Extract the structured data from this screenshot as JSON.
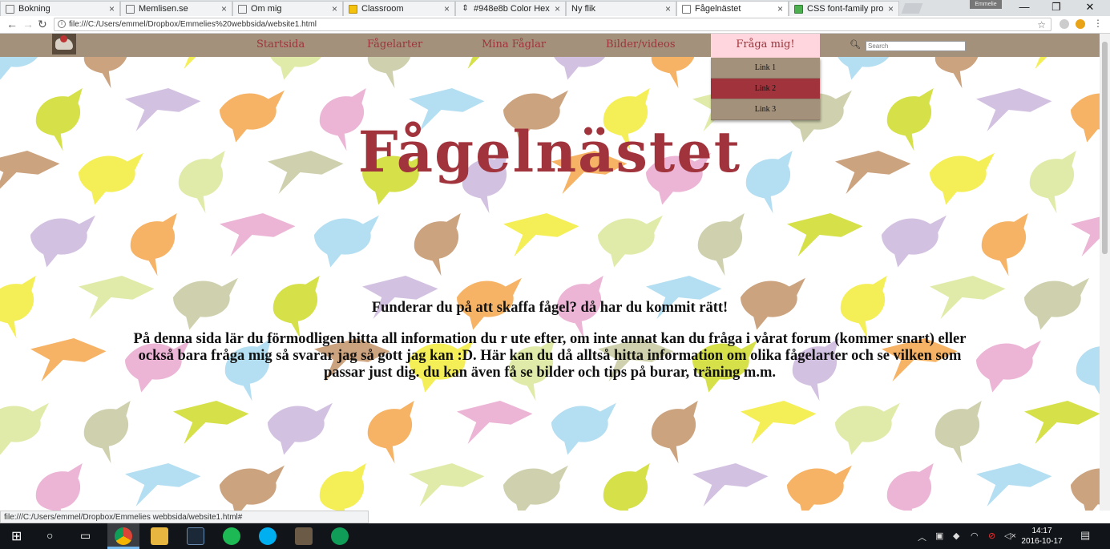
{
  "browser": {
    "tabs": [
      {
        "title": "Bokning"
      },
      {
        "title": "Memlisen.se"
      },
      {
        "title": "Om mig"
      },
      {
        "title": "Classroom"
      },
      {
        "title": "#948e8b Color Hex"
      },
      {
        "title": "Ny flik"
      },
      {
        "title": "Fågelnästet"
      },
      {
        "title": "CSS font-family pro"
      }
    ],
    "profile_label": "Emmelie",
    "url": "file:///C:/Users/emmel/Dropbox/Emmelies%20webbsida/website1.html",
    "status_url": "file:///C:/Users/emmel/Dropbox/Emmelies webbsida/website1.html#"
  },
  "site": {
    "nav": [
      {
        "label": "Startsida"
      },
      {
        "label": "Fågelarter"
      },
      {
        "label": "Mina Fåglar"
      },
      {
        "label": "Bilder/videos"
      },
      {
        "label": "Fråga mig!"
      }
    ],
    "dropdown": [
      {
        "label": "Link 1"
      },
      {
        "label": "Link 2"
      },
      {
        "label": "Link 3"
      }
    ],
    "search_placeholder": "Search",
    "heading": "Fågelnästet",
    "intro_line1": "Funderar du på att skaffa fågel? då har du kommit rätt!",
    "intro_line2": "På denna sida lär du förmodligen hitta all information du r ute efter, om inte annat kan du fråga i vårat forum (kommer snart) eller också bara fråga mig så svarar jag så gott jag kan :D. Här kan du då alltså hitta information om olika fågelarter och se vilken som passar just dig. du kan även få se bilder och tips på burar, träning m.m.",
    "colors": {
      "accent": "#a0333b",
      "nav_bg": "#a3917c",
      "active_nav_bg": "#ffd6dd"
    }
  },
  "taskbar": {
    "time": "14:17",
    "date": "2016-10-17"
  }
}
